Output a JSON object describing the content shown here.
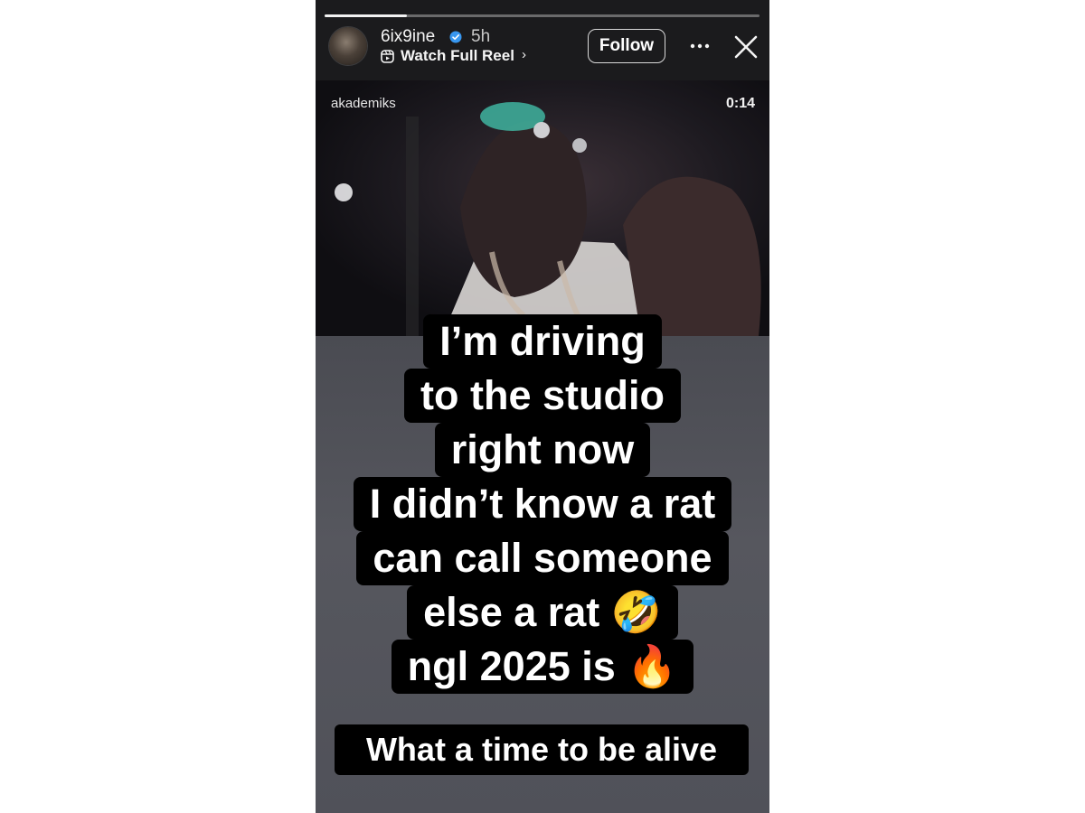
{
  "header": {
    "username": "6ix9ine",
    "verified_icon": "verified-badge-icon",
    "time_ago": "5h",
    "reel_link_label": "Watch Full Reel",
    "reel_link_chevron": "›",
    "follow_label": "Follow",
    "more_icon": "ellipsis-icon",
    "close_icon": "close-icon"
  },
  "progress": {
    "fraction": 0.19
  },
  "video": {
    "source_handle": "akademiks",
    "timestamp": "0:14"
  },
  "caption": {
    "lines": [
      "I’m driving",
      "to the studio",
      "right now",
      "I didn’t know a rat",
      "can call someone",
      "else a rat 🤣",
      "ngl 2025 is 🔥"
    ],
    "footer": "What a time to be alive"
  },
  "colors": {
    "caption_bg": "#000000",
    "caption_text": "#ffffff",
    "header_bg": "#1b1b1d"
  }
}
